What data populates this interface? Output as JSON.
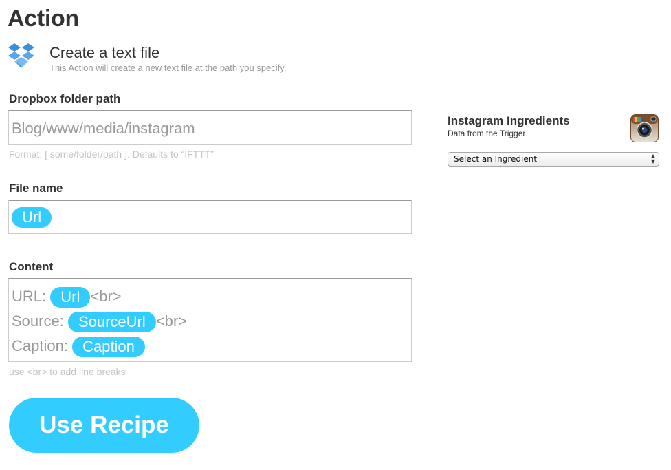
{
  "page_title": "Action",
  "action": {
    "name": "Create a text file",
    "description": "This Action will create a new text file at the path you specify."
  },
  "folder_path": {
    "label": "Dropbox folder path",
    "value": "Blog/www/media/instagram",
    "hint": "Format: [ some/folder/path ]. Defaults to “IFTTT”"
  },
  "file_name": {
    "label": "File name",
    "pill": "Url"
  },
  "content": {
    "label": "Content",
    "lines": [
      {
        "prefix": "URL: ",
        "pill": "Url",
        "suffix": "<br>"
      },
      {
        "prefix": "Source: ",
        "pill": "SourceUrl",
        "suffix": "<br>"
      },
      {
        "prefix": "Caption: ",
        "pill": "Caption",
        "suffix": ""
      }
    ],
    "hint": "use <br> to add line breaks"
  },
  "use_recipe_label": "Use Recipe",
  "ingredients": {
    "title": "Instagram Ingredients",
    "subtitle": "Data from the Trigger",
    "select_value": "Select an Ingredient"
  },
  "icons": {
    "action_channel": "dropbox-icon",
    "trigger_channel": "instagram-icon"
  },
  "colors": {
    "accent": "#33ccff",
    "hint": "#c4c4c4",
    "field_text": "#999999"
  }
}
